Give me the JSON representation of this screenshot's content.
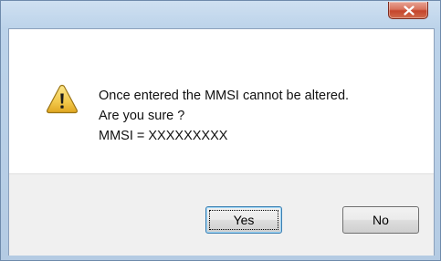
{
  "dialog": {
    "title": "",
    "close_glyph": "x",
    "icon": "warning-icon",
    "message_lines": [
      "Once entered the MMSI cannot be altered.",
      "Are you sure ?",
      "MMSI = XXXXXXXXX"
    ],
    "buttons": {
      "yes_label": "Yes",
      "no_label": "No"
    },
    "colors": {
      "close_button": "#c5452c",
      "warning_fill": "#f2c84b",
      "frame": "#bcd3ea"
    }
  }
}
